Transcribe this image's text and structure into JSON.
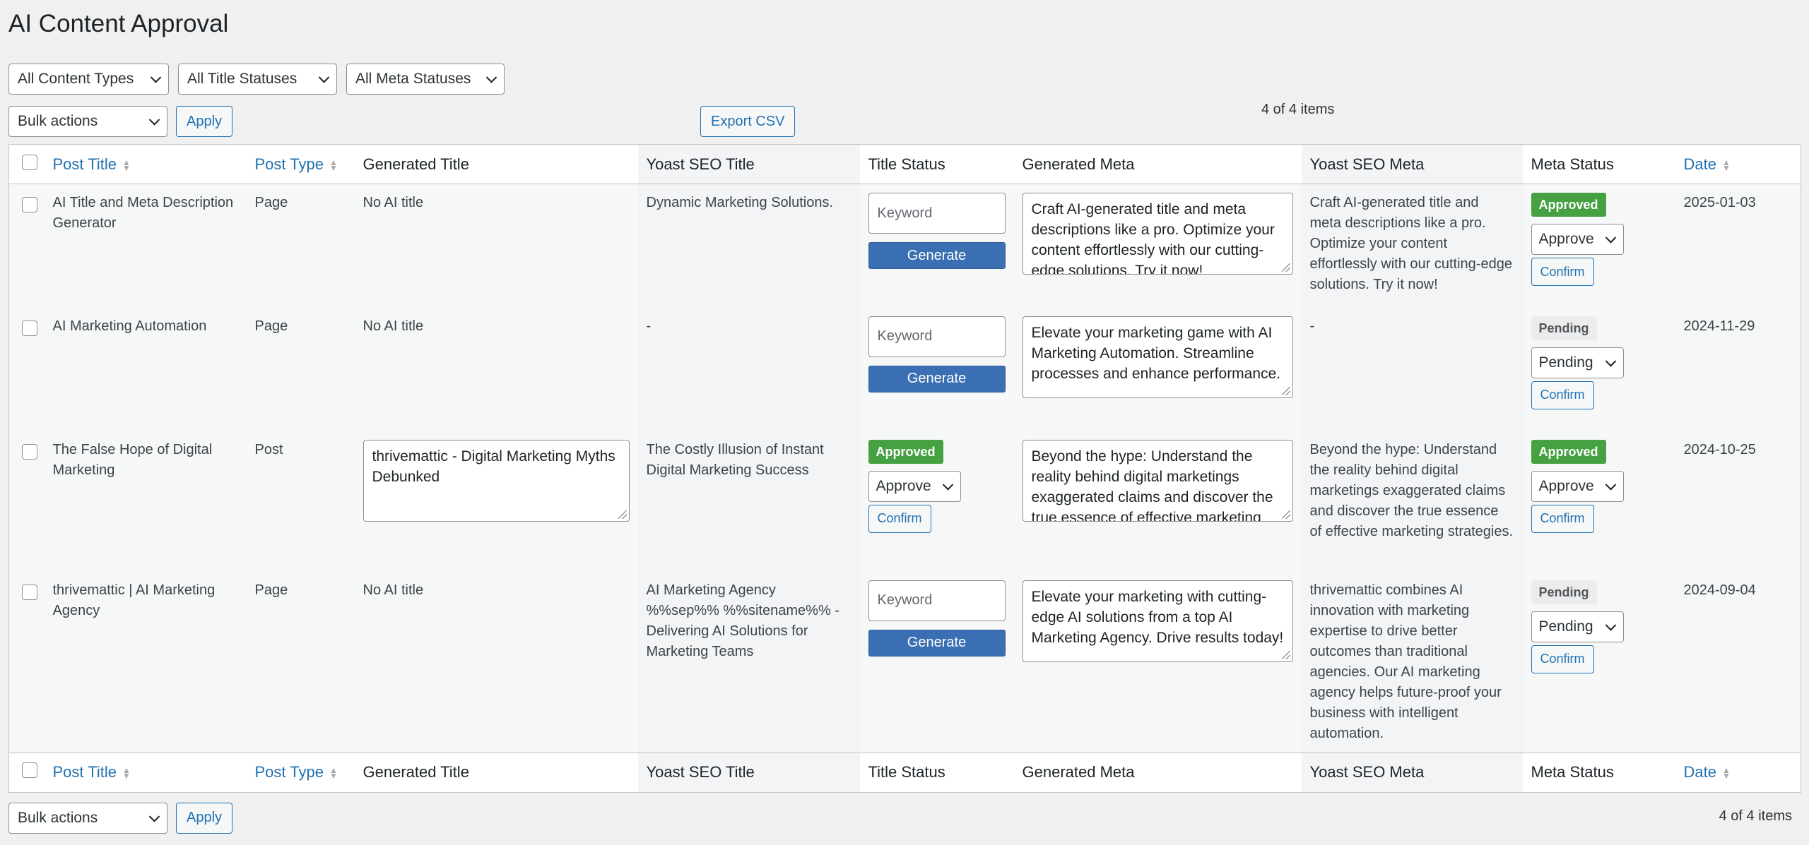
{
  "page": {
    "title": "AI Content Approval"
  },
  "filters": {
    "content_types": "All Content Types",
    "title_statuses": "All Title Statuses",
    "meta_statuses": "All Meta Statuses"
  },
  "bulk": {
    "label": "Bulk actions",
    "apply": "Apply"
  },
  "export": "Export CSV",
  "count": "4 of 4 items",
  "columns": {
    "post_title": "Post Title",
    "post_type": "Post Type",
    "generated_title": "Generated Title",
    "yoast_title": "Yoast SEO Title",
    "title_status": "Title Status",
    "generated_meta": "Generated Meta",
    "yoast_meta": "Yoast SEO Meta",
    "meta_status": "Meta Status",
    "date": "Date"
  },
  "labels": {
    "keyword_placeholder": "Keyword",
    "generate": "Generate",
    "confirm": "Confirm"
  },
  "rows": [
    {
      "post_title": "AI Title and Meta Description Generator",
      "post_type": "Page",
      "generated_title": "No AI title",
      "yoast_title": "Dynamic Marketing Solutions.",
      "generated_meta": "Craft AI-generated title and meta descriptions like a pro. Optimize your content effortlessly with our cutting-edge solutions. Try it now!",
      "yoast_meta": "Craft AI-generated title and meta descriptions like a pro. Optimize your content effortlessly with our cutting-edge solutions. Try it now!",
      "meta_badge": "Approved",
      "meta_select": "Approve",
      "date": "2025-01-03"
    },
    {
      "post_title": "AI Marketing Automation",
      "post_type": "Page",
      "generated_title": "No AI title",
      "yoast_title": "-",
      "generated_meta": "Elevate your marketing game with AI Marketing Automation. Streamline processes and enhance performance.",
      "yoast_meta": "-",
      "meta_badge": "Pending",
      "meta_select": "Pending",
      "date": "2024-11-29"
    },
    {
      "post_title": "The False Hope of Digital Marketing",
      "post_type": "Post",
      "generated_title": "thrivemattic - Digital Marketing Myths Debunked",
      "yoast_title": "The Costly Illusion of Instant Digital Marketing Success",
      "title_badge": "Approved",
      "title_select": "Approve",
      "generated_meta": "Beyond the hype: Understand the reality behind digital marketings exaggerated claims and discover the true essence of effective marketing strategies.",
      "yoast_meta": "Beyond the hype: Understand the reality behind digital marketings exaggerated claims and discover the true essence of effective marketing strategies.",
      "meta_badge": "Approved",
      "meta_select": "Approve",
      "date": "2024-10-25"
    },
    {
      "post_title": "thrivemattic | AI Marketing Agency",
      "post_type": "Page",
      "generated_title": "No AI title",
      "yoast_title": "AI Marketing Agency %%sep%% %%sitename%% - Delivering AI Solutions for Marketing Teams",
      "generated_meta": "Elevate your marketing with cutting-edge AI solutions from a top AI Marketing Agency. Drive results today!",
      "yoast_meta": "thrivemattic combines AI innovation with marketing expertise to drive better outcomes than traditional agencies. Our AI marketing agency helps future-proof your business with intelligent automation.",
      "meta_badge": "Pending",
      "meta_select": "Pending",
      "date": "2024-09-04"
    }
  ]
}
